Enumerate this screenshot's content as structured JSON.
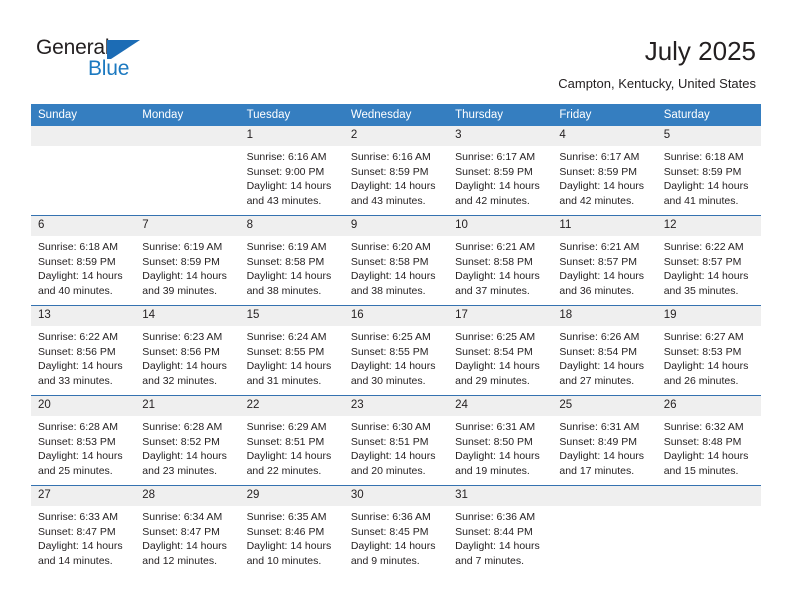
{
  "brand": {
    "name_top": "General",
    "name_bottom": "Blue",
    "accent_color": "#1c6cb5"
  },
  "header": {
    "title": "July 2025",
    "location": "Campton, Kentucky, United States"
  },
  "calendar": {
    "header_bg": "#357ec0",
    "daynum_bg": "#efefef",
    "grid_line": "#3572b0",
    "weekday_labels": [
      "Sunday",
      "Monday",
      "Tuesday",
      "Wednesday",
      "Thursday",
      "Friday",
      "Saturday"
    ],
    "weeks": [
      [
        {
          "empty": true
        },
        {
          "empty": true
        },
        {
          "day": "1",
          "sunrise": "Sunrise: 6:16 AM",
          "sunset": "Sunset: 9:00 PM",
          "daylight": "Daylight: 14 hours and 43 minutes."
        },
        {
          "day": "2",
          "sunrise": "Sunrise: 6:16 AM",
          "sunset": "Sunset: 8:59 PM",
          "daylight": "Daylight: 14 hours and 43 minutes."
        },
        {
          "day": "3",
          "sunrise": "Sunrise: 6:17 AM",
          "sunset": "Sunset: 8:59 PM",
          "daylight": "Daylight: 14 hours and 42 minutes."
        },
        {
          "day": "4",
          "sunrise": "Sunrise: 6:17 AM",
          "sunset": "Sunset: 8:59 PM",
          "daylight": "Daylight: 14 hours and 42 minutes."
        },
        {
          "day": "5",
          "sunrise": "Sunrise: 6:18 AM",
          "sunset": "Sunset: 8:59 PM",
          "daylight": "Daylight: 14 hours and 41 minutes."
        }
      ],
      [
        {
          "day": "6",
          "sunrise": "Sunrise: 6:18 AM",
          "sunset": "Sunset: 8:59 PM",
          "daylight": "Daylight: 14 hours and 40 minutes."
        },
        {
          "day": "7",
          "sunrise": "Sunrise: 6:19 AM",
          "sunset": "Sunset: 8:59 PM",
          "daylight": "Daylight: 14 hours and 39 minutes."
        },
        {
          "day": "8",
          "sunrise": "Sunrise: 6:19 AM",
          "sunset": "Sunset: 8:58 PM",
          "daylight": "Daylight: 14 hours and 38 minutes."
        },
        {
          "day": "9",
          "sunrise": "Sunrise: 6:20 AM",
          "sunset": "Sunset: 8:58 PM",
          "daylight": "Daylight: 14 hours and 38 minutes."
        },
        {
          "day": "10",
          "sunrise": "Sunrise: 6:21 AM",
          "sunset": "Sunset: 8:58 PM",
          "daylight": "Daylight: 14 hours and 37 minutes."
        },
        {
          "day": "11",
          "sunrise": "Sunrise: 6:21 AM",
          "sunset": "Sunset: 8:57 PM",
          "daylight": "Daylight: 14 hours and 36 minutes."
        },
        {
          "day": "12",
          "sunrise": "Sunrise: 6:22 AM",
          "sunset": "Sunset: 8:57 PM",
          "daylight": "Daylight: 14 hours and 35 minutes."
        }
      ],
      [
        {
          "day": "13",
          "sunrise": "Sunrise: 6:22 AM",
          "sunset": "Sunset: 8:56 PM",
          "daylight": "Daylight: 14 hours and 33 minutes."
        },
        {
          "day": "14",
          "sunrise": "Sunrise: 6:23 AM",
          "sunset": "Sunset: 8:56 PM",
          "daylight": "Daylight: 14 hours and 32 minutes."
        },
        {
          "day": "15",
          "sunrise": "Sunrise: 6:24 AM",
          "sunset": "Sunset: 8:55 PM",
          "daylight": "Daylight: 14 hours and 31 minutes."
        },
        {
          "day": "16",
          "sunrise": "Sunrise: 6:25 AM",
          "sunset": "Sunset: 8:55 PM",
          "daylight": "Daylight: 14 hours and 30 minutes."
        },
        {
          "day": "17",
          "sunrise": "Sunrise: 6:25 AM",
          "sunset": "Sunset: 8:54 PM",
          "daylight": "Daylight: 14 hours and 29 minutes."
        },
        {
          "day": "18",
          "sunrise": "Sunrise: 6:26 AM",
          "sunset": "Sunset: 8:54 PM",
          "daylight": "Daylight: 14 hours and 27 minutes."
        },
        {
          "day": "19",
          "sunrise": "Sunrise: 6:27 AM",
          "sunset": "Sunset: 8:53 PM",
          "daylight": "Daylight: 14 hours and 26 minutes."
        }
      ],
      [
        {
          "day": "20",
          "sunrise": "Sunrise: 6:28 AM",
          "sunset": "Sunset: 8:53 PM",
          "daylight": "Daylight: 14 hours and 25 minutes."
        },
        {
          "day": "21",
          "sunrise": "Sunrise: 6:28 AM",
          "sunset": "Sunset: 8:52 PM",
          "daylight": "Daylight: 14 hours and 23 minutes."
        },
        {
          "day": "22",
          "sunrise": "Sunrise: 6:29 AM",
          "sunset": "Sunset: 8:51 PM",
          "daylight": "Daylight: 14 hours and 22 minutes."
        },
        {
          "day": "23",
          "sunrise": "Sunrise: 6:30 AM",
          "sunset": "Sunset: 8:51 PM",
          "daylight": "Daylight: 14 hours and 20 minutes."
        },
        {
          "day": "24",
          "sunrise": "Sunrise: 6:31 AM",
          "sunset": "Sunset: 8:50 PM",
          "daylight": "Daylight: 14 hours and 19 minutes."
        },
        {
          "day": "25",
          "sunrise": "Sunrise: 6:31 AM",
          "sunset": "Sunset: 8:49 PM",
          "daylight": "Daylight: 14 hours and 17 minutes."
        },
        {
          "day": "26",
          "sunrise": "Sunrise: 6:32 AM",
          "sunset": "Sunset: 8:48 PM",
          "daylight": "Daylight: 14 hours and 15 minutes."
        }
      ],
      [
        {
          "day": "27",
          "sunrise": "Sunrise: 6:33 AM",
          "sunset": "Sunset: 8:47 PM",
          "daylight": "Daylight: 14 hours and 14 minutes."
        },
        {
          "day": "28",
          "sunrise": "Sunrise: 6:34 AM",
          "sunset": "Sunset: 8:47 PM",
          "daylight": "Daylight: 14 hours and 12 minutes."
        },
        {
          "day": "29",
          "sunrise": "Sunrise: 6:35 AM",
          "sunset": "Sunset: 8:46 PM",
          "daylight": "Daylight: 14 hours and 10 minutes."
        },
        {
          "day": "30",
          "sunrise": "Sunrise: 6:36 AM",
          "sunset": "Sunset: 8:45 PM",
          "daylight": "Daylight: 14 hours and 9 minutes."
        },
        {
          "day": "31",
          "sunrise": "Sunrise: 6:36 AM",
          "sunset": "Sunset: 8:44 PM",
          "daylight": "Daylight: 14 hours and 7 minutes."
        },
        {
          "empty": true
        },
        {
          "empty": true
        }
      ]
    ]
  }
}
